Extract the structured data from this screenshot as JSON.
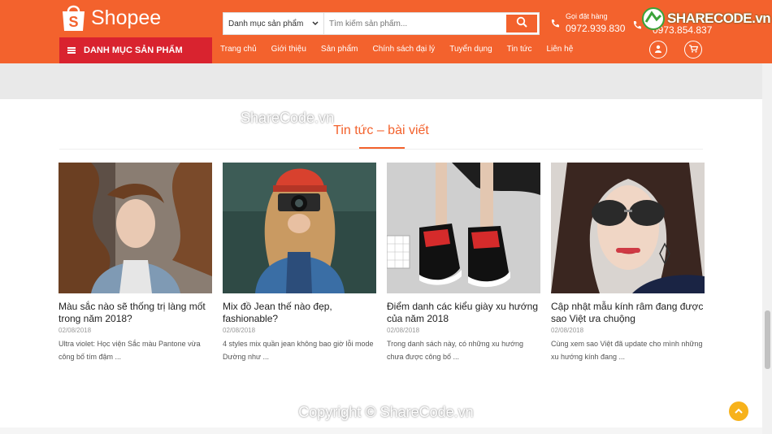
{
  "header": {
    "logo_text": "Shopee",
    "search": {
      "category": "Danh mục sản phẩm",
      "placeholder": "Tìm kiếm sản phẩm..."
    },
    "hotline1": {
      "label": "Gọi đặt hàng",
      "number": "0972.939.830"
    },
    "hotline2": {
      "number": "0973.854.837"
    },
    "category_menu": "DANH MỤC SẢN PHẨM",
    "nav": [
      "Trang chủ",
      "Giới thiệu",
      "Sản phẩm",
      "Chính sách đại lý",
      "Tuyển dụng",
      "Tin tức",
      "Liên hệ"
    ],
    "brand_color": "#f3622d"
  },
  "watermark": {
    "logo": "SHARECODE.vn",
    "center": "ShareCode.vn",
    "footer": "Copyright © ShareCode.vn"
  },
  "section": {
    "title": "Tin tức – bài viết",
    "posts": [
      {
        "title": "Màu sắc nào sẽ thống trị làng mốt trong năm 2018?",
        "date": "02/08/2018",
        "desc": "Ultra violet: Học viện Sắc màu Pantone vừa công bố tím đậm ..."
      },
      {
        "title": "Mix đồ Jean thế nào đẹp, fashionable?",
        "date": "02/08/2018",
        "desc": "4 styles mix quần jean không bao giờ lỗi mode Dường như ..."
      },
      {
        "title": "Điểm danh các kiểu giày xu hướng của năm 2018",
        "date": "02/08/2018",
        "desc": "Trong danh sách này, có những xu hướng chưa được công bố ..."
      },
      {
        "title": "Cập nhật mẫu kính râm đang được sao Việt ưa chuộng",
        "date": "02/08/2018",
        "desc": "Cùng xem sao Việt đã update cho mình những xu hướng kính đang ..."
      }
    ]
  },
  "icons": [
    "shopee-bag-icon",
    "chevron-down-icon",
    "search-icon",
    "phone-icon",
    "menu-icon",
    "user-icon",
    "cart-icon",
    "arrow-up-icon"
  ]
}
